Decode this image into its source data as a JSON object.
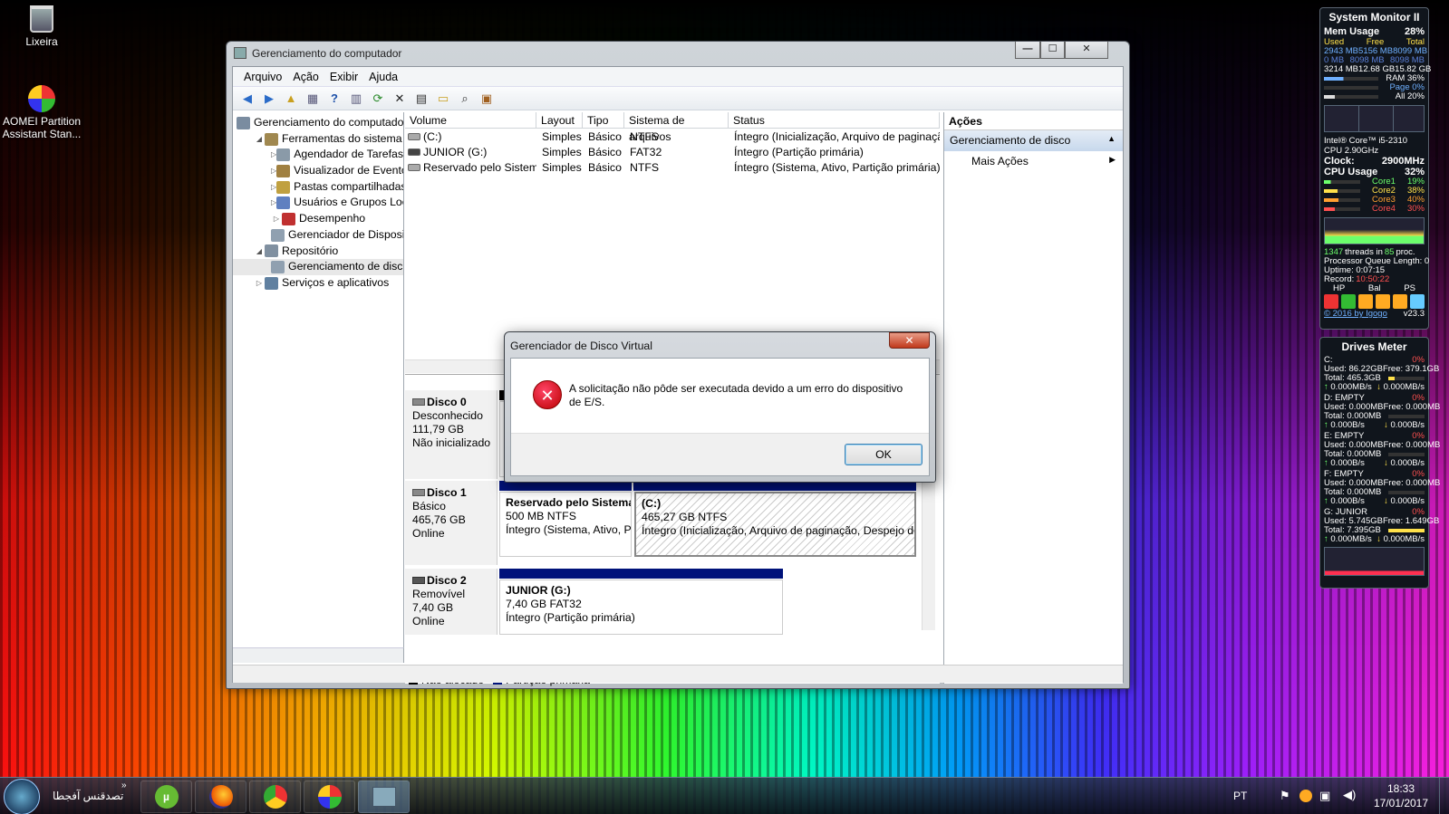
{
  "desktop": {
    "icons": [
      {
        "label": "Lixeira"
      },
      {
        "label": "AOMEI Partition Assistant Stan..."
      }
    ]
  },
  "window": {
    "title": "Gerenciamento do computador",
    "controls": {
      "minimize": "—",
      "maximize": "☐",
      "close": "✕"
    },
    "menu": [
      "Arquivo",
      "Ação",
      "Exibir",
      "Ajuda"
    ],
    "tree": [
      {
        "label": "Gerenciamento do computado",
        "level": 0,
        "exp": ""
      },
      {
        "label": "Ferramentas do sistema",
        "level": 1,
        "exp": "◢"
      },
      {
        "label": "Agendador de Tarefas",
        "level": 2,
        "exp": "▷"
      },
      {
        "label": "Visualizador de Eventos",
        "level": 2,
        "exp": "▷"
      },
      {
        "label": "Pastas compartilhadas",
        "level": 2,
        "exp": "▷"
      },
      {
        "label": "Usuários e Grupos Loca",
        "level": 2,
        "exp": "▷"
      },
      {
        "label": "Desempenho",
        "level": 2,
        "exp": "▷"
      },
      {
        "label": "Gerenciador de Disposit",
        "level": 2,
        "exp": ""
      },
      {
        "label": "Repositório",
        "level": 1,
        "exp": "◢"
      },
      {
        "label": "Gerenciamento de disco",
        "level": 2,
        "exp": ""
      },
      {
        "label": "Serviços e aplicativos",
        "level": 1,
        "exp": "▷"
      }
    ],
    "volume_table": {
      "headers": [
        "Volume",
        "Layout",
        "Tipo",
        "Sistema de arquivos",
        "Status"
      ],
      "rows": [
        [
          "(C:)",
          "Simples",
          "Básico",
          "NTFS",
          "Íntegro (Inicialização, Arquivo de paginaçã"
        ],
        [
          "JUNIOR (G:)",
          "Simples",
          "Básico",
          "FAT32",
          "Íntegro (Partição primária)"
        ],
        [
          "Reservado pelo Sistema",
          "Simples",
          "Básico",
          "NTFS",
          "Íntegro (Sistema, Ativo, Partição primária)"
        ]
      ]
    },
    "disks": [
      {
        "name": "Disco 0",
        "type": "Desconhecido",
        "size": "111,79 GB",
        "state": "Não inicializado"
      },
      {
        "name": "Disco 1",
        "type": "Básico",
        "size": "465,76 GB",
        "state": "Online"
      },
      {
        "name": "Disco 2",
        "type": "Removível",
        "size": "7,40 GB",
        "state": "Online"
      }
    ],
    "partitions": [
      {
        "name": "Reservado pelo Sistema",
        "size": "500 MB NTFS",
        "status": "Íntegro (Sistema, Ativo, Pa"
      },
      {
        "name": "(C:)",
        "size": "465,27 GB NTFS",
        "status": "Íntegro (Inicialização, Arquivo de paginação, Despejo de n"
      },
      {
        "name": "JUNIOR  (G:)",
        "size": "7,40 GB FAT32",
        "status": "Íntegro (Partição primária)"
      }
    ],
    "legend": [
      "Não alocado",
      "Partição primária"
    ],
    "actions": {
      "title": "Ações",
      "section": "Gerenciamento de disco",
      "item": "Mais Ações"
    }
  },
  "dialog": {
    "title": "Gerenciador de Disco Virtual",
    "close": "✕",
    "message": "A solicitação não pôde ser executada devido a um erro do dispositivo de E/S.",
    "ok": "OK"
  },
  "gadget_sysmon": {
    "title": "System Monitor II",
    "mem_label": "Mem Usage",
    "mem_pct": "28%",
    "mem_headers": [
      "Used",
      "Free",
      "Total"
    ],
    "mem_rows": [
      [
        "2943 MB",
        "5156 MB",
        "8099 MB"
      ],
      [
        "0 MB",
        "8098 MB",
        "8098 MB"
      ],
      [
        "3214 MB",
        "12.68 GB",
        "15.82 GB"
      ]
    ],
    "ram_lines": [
      [
        "RAM",
        "36%"
      ],
      [
        "Page",
        "0%"
      ],
      [
        "All",
        "20%"
      ]
    ],
    "cpu_name": "Intel® Core™ i5-2310 CPU 2.90GHz",
    "clock_label": "Clock:",
    "clock": "2900MHz",
    "cpu_label": "CPU Usage",
    "cpu_pct": "32%",
    "cores": [
      [
        "Core1",
        "19%"
      ],
      [
        "Core2",
        "38%"
      ],
      [
        "Core3",
        "40%"
      ],
      [
        "Core4",
        "30%"
      ]
    ],
    "threads": "1347",
    "procs": "85",
    "threads_text": "threads in",
    "procs_text": "proc.",
    "queue": "Processor Queue Length: 0",
    "uptime": "Uptime: 0:07:15",
    "record": "Record:",
    "record_val": "10:50:22",
    "modes": [
      "HP",
      "Bal",
      "PS"
    ],
    "credit": "© 2016 by Igogo",
    "version": "v23.3"
  },
  "gadget_drives": {
    "title": "Drives Meter",
    "drives": [
      {
        "name": "C:",
        "pct": "0%",
        "used": "Used: 86.22GB",
        "free": "Free: 379.1GB",
        "total": "Total: 465.3GB",
        "r": "0.000MB/s",
        "w": "0.000MB/s"
      },
      {
        "name": "D: EMPTY",
        "pct": "0%",
        "used": "Used: 0.000MB",
        "free": "Free: 0.000MB",
        "total": "Total: 0.000MB",
        "r": "0.000B/s",
        "w": "0.000B/s"
      },
      {
        "name": "E: EMPTY",
        "pct": "0%",
        "used": "Used: 0.000MB",
        "free": "Free: 0.000MB",
        "total": "Total: 0.000MB",
        "r": "0.000B/s",
        "w": "0.000B/s"
      },
      {
        "name": "F: EMPTY",
        "pct": "0%",
        "used": "Used: 0.000MB",
        "free": "Free: 0.000MB",
        "total": "Total: 0.000MB",
        "r": "0.000B/s",
        "w": "0.000B/s"
      },
      {
        "name": "G: JUNIOR",
        "pct": "0%",
        "used": "Used: 5.745GB",
        "free": "Free: 1.649GB",
        "total": "Total: 7.395GB",
        "r": "0.000MB/s",
        "w": "0.000MB/s"
      }
    ]
  },
  "taskbar": {
    "start_label": "تصدقنس آفجطا",
    "lang": "PT",
    "time": "18:33",
    "date": "17/01/2017"
  }
}
